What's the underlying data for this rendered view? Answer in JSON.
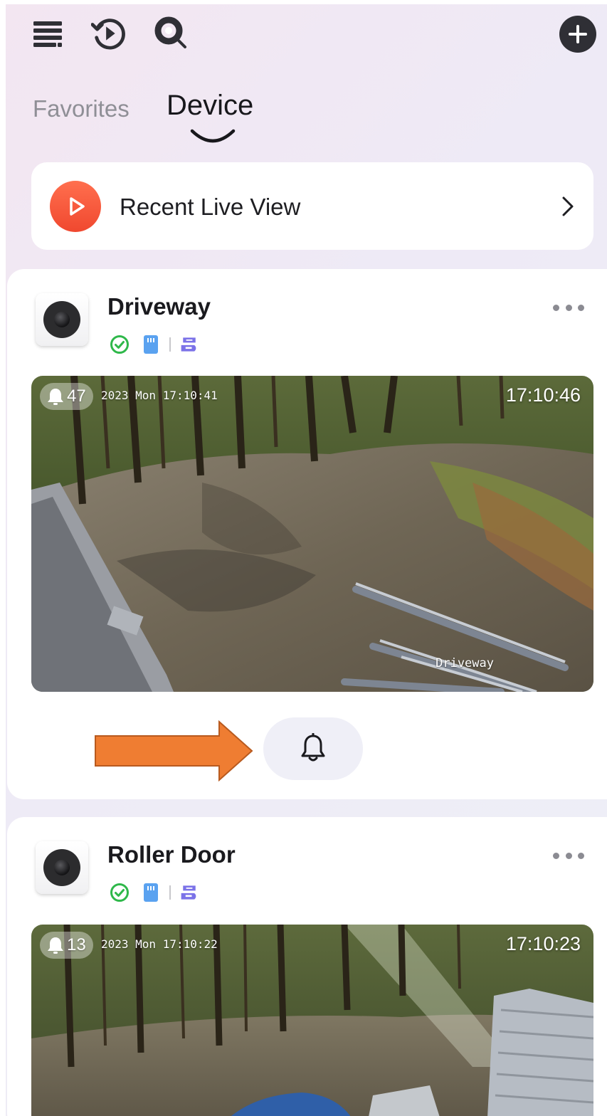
{
  "tabs": [
    {
      "label": "Favorites",
      "active": false
    },
    {
      "label": "Device",
      "active": true
    }
  ],
  "recent_live_view": {
    "label": "Recent Live View"
  },
  "devices": [
    {
      "name": "Driveway",
      "alert_count": "47",
      "osd_date": "2023 Mon 17:10:41",
      "time": "17:10:46",
      "osd_name": "Driveway"
    },
    {
      "name": "Roller Door",
      "alert_count": "13",
      "osd_date": "2023 Mon 17:10:22",
      "time": "17:10:23"
    }
  ],
  "icons": {
    "menu": "menu-icon",
    "history": "playback-history-icon",
    "search": "search-icon",
    "add": "add-icon",
    "play": "play-icon",
    "chevron": "chevron-right-icon",
    "online": "online-check-icon",
    "sd_card": "sd-card-icon",
    "cloud": "cloud-storage-icon",
    "bell": "bell-icon",
    "more": "more-icon"
  },
  "colors": {
    "accent_orange": "#f25535",
    "online_green": "#2fb84a",
    "storage_blue": "#5aa2f0",
    "cloud_purple": "#7b72e8",
    "annotation_arrow": "#ef7d32"
  }
}
